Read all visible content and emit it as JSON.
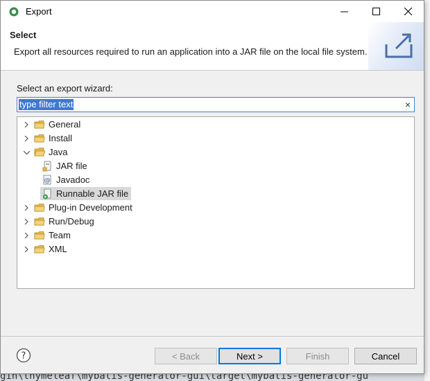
{
  "window": {
    "title": "Export",
    "colors": {
      "accent": "#0078d7",
      "selection": "#3b79d6",
      "folder": "#e8b84a"
    }
  },
  "banner": {
    "title": "Select",
    "description": "Export all resources required to run an application into a JAR file on the local file system."
  },
  "wizard": {
    "label": "Select an export wizard:",
    "filter_value": "type filter text",
    "clear_icon": "×"
  },
  "tree": {
    "items": [
      {
        "label": "General",
        "expanded": false,
        "icon": "folder-icon",
        "depth": 0
      },
      {
        "label": "Install",
        "expanded": false,
        "icon": "folder-icon",
        "depth": 0
      },
      {
        "label": "Java",
        "expanded": true,
        "icon": "folder-open-icon",
        "depth": 0
      },
      {
        "label": "JAR file",
        "icon": "jar-file-icon",
        "depth": 1
      },
      {
        "label": "Javadoc",
        "icon": "javadoc-icon",
        "depth": 1
      },
      {
        "label": "Runnable JAR file",
        "icon": "runnable-jar-icon",
        "depth": 1,
        "selected": true
      },
      {
        "label": "Plug-in Development",
        "expanded": false,
        "icon": "folder-icon",
        "depth": 0
      },
      {
        "label": "Run/Debug",
        "expanded": false,
        "icon": "folder-icon",
        "depth": 0
      },
      {
        "label": "Team",
        "expanded": false,
        "icon": "folder-icon",
        "depth": 0
      },
      {
        "label": "XML",
        "expanded": false,
        "icon": "folder-icon",
        "depth": 0
      }
    ]
  },
  "buttons": {
    "back": "< Back",
    "next": "Next >",
    "finish": "Finish",
    "cancel": "Cancel"
  },
  "background": {
    "path_text": "gin\\thymeleaf\\mybatis-generator-gui\\target\\mybatis-generator-gu"
  }
}
